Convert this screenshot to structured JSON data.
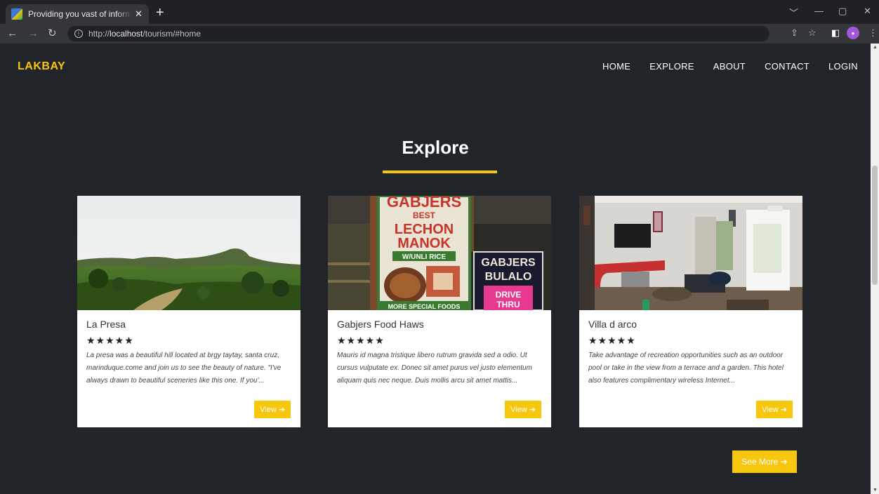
{
  "browser": {
    "tab_title": "Providing you vast of information",
    "tab_close": "✕",
    "new_tab": "+",
    "url_prefix": "http://",
    "url_host": "localhost",
    "url_path": "/tourism/#home",
    "win_chevron": "﹀",
    "win_min": "—",
    "win_max": "▢",
    "win_close": "✕",
    "back": "←",
    "forward": "→",
    "reload": "↻",
    "share": "⇪",
    "bookmark": "☆",
    "sidepanel": "◧",
    "menu": "⋮",
    "avatar": "●"
  },
  "site": {
    "brand": "LAKBAY",
    "nav": [
      {
        "label": "HOME"
      },
      {
        "label": "EXPLORE"
      },
      {
        "label": "ABOUT"
      },
      {
        "label": "CONTACT"
      },
      {
        "label": "LOGIN"
      }
    ],
    "section_title": "Explore",
    "stars": "★★★★★",
    "cards": [
      {
        "name": "La Presa",
        "description": "La presa was a beautiful hill located at brgy taytay, santa cruz, marinduque.come and join us to see the beauty of nature. \"I've always drawn to beautiful sceneries like this one. If you'...",
        "button": "View ➔"
      },
      {
        "name": "Gabjers Food Haws",
        "description": "Mauris id magna tristique libero rutrum gravida sed a odio. Ut cursus vulputate ex. Donec sit amet purus vel justo elementum aliquam quis nec neque. Duis mollis arcu sit amet mattis...",
        "button": "View ➔"
      },
      {
        "name": "Villa d arco",
        "description": "Take advantage of recreation opportunities such as an outdoor pool or take in the view from a terrace and a garden. This hotel also features complimentary wireless Internet...",
        "button": "View ➔"
      }
    ],
    "see_more": "See More ➔",
    "sign_text": {
      "top": "GABJERS",
      "best": "BEST",
      "lechon": "LECHON",
      "manok": "MANOK",
      "unli": "W/UNLI RICE",
      "more": "MORE SPECIAL FOODS",
      "gabjers2": "GABJERS",
      "bulalo": "BULALO",
      "drive": "DRIVE",
      "thru": "THRU"
    }
  },
  "colors": {
    "accent": "#f7c60f",
    "page_bg": "#212529"
  }
}
